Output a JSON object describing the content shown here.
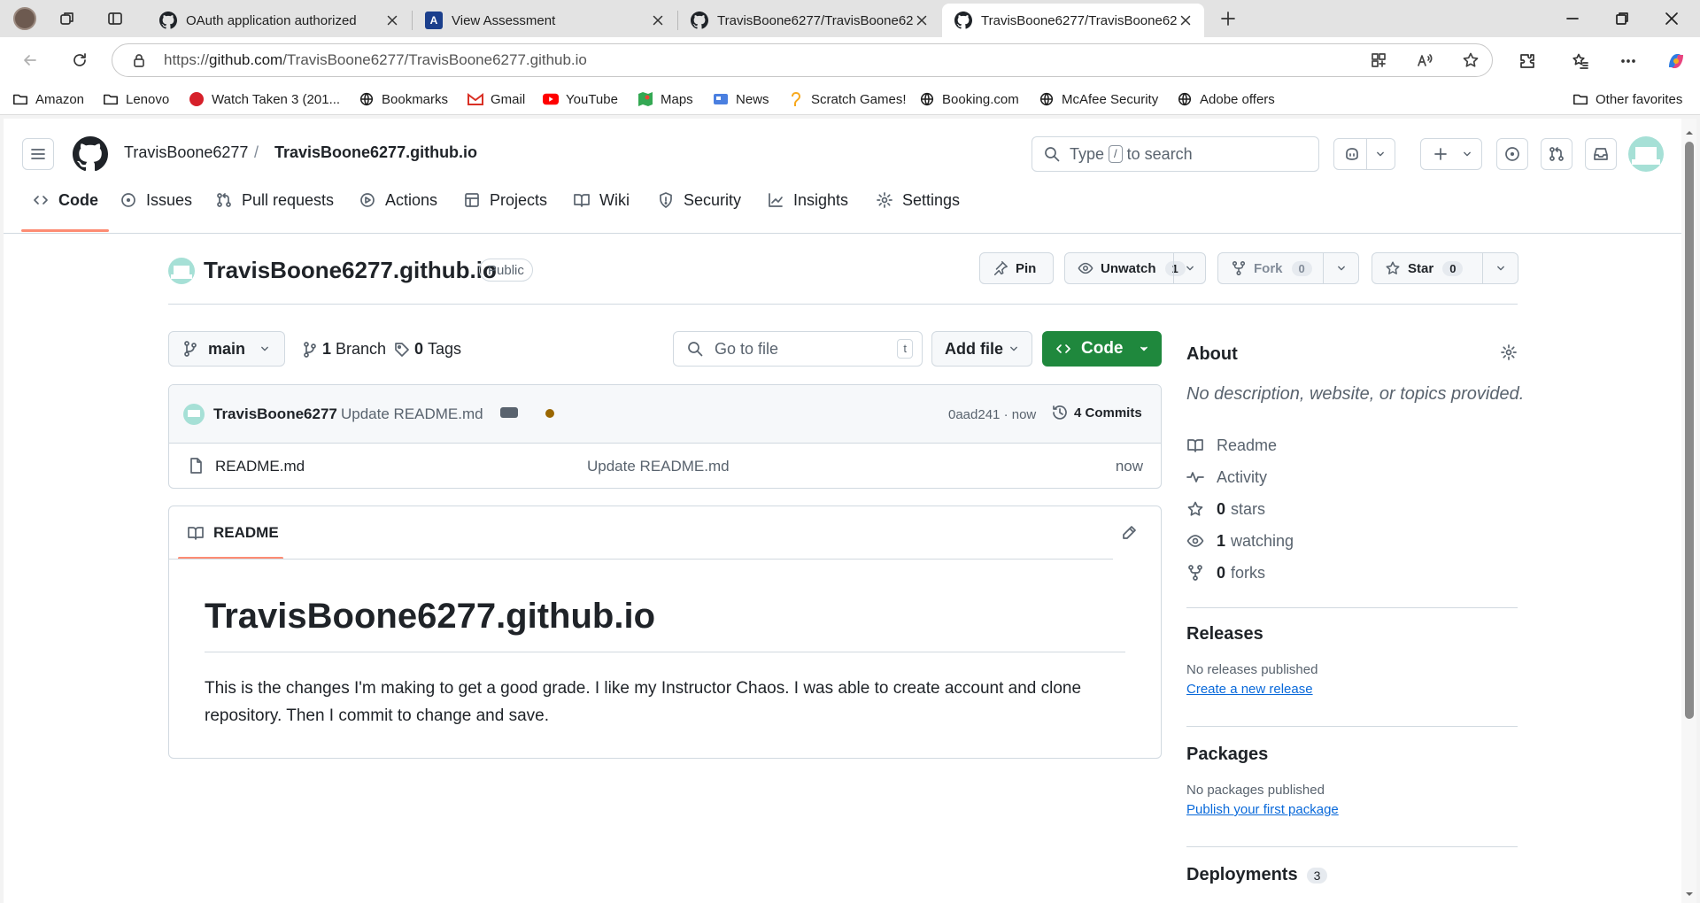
{
  "browser": {
    "tabs": [
      {
        "title": "OAuth application authorized",
        "icon": "github-icon"
      },
      {
        "title": "View Assessment",
        "icon": "assessment-icon"
      },
      {
        "title": "TravisBoone6277/TravisBoone6277.github.io",
        "icon": "github-icon"
      },
      {
        "title": "TravisBoone6277/TravisBoone6277.github.io",
        "icon": "github-icon"
      }
    ],
    "url_prefix": "https://",
    "url_host": "github.com",
    "url_path": "/TravisBoone6277/TravisBoone6277.github.io",
    "favorites": [
      "Amazon",
      "Lenovo",
      "Watch Taken 3 (201...",
      "Bookmarks",
      "Gmail",
      "YouTube",
      "Maps",
      "News",
      "Scratch Games!",
      "Booking.com",
      "McAfee Security",
      "Adobe offers"
    ],
    "other_favorites": "Other favorites"
  },
  "github": {
    "owner": "TravisBoone6277",
    "separator": "/",
    "repo": "TravisBoone6277.github.io",
    "search_prefix": "Type",
    "search_key": "/",
    "search_suffix": "to search",
    "nav": [
      "Code",
      "Issues",
      "Pull requests",
      "Actions",
      "Projects",
      "Wiki",
      "Security",
      "Insights",
      "Settings"
    ],
    "visibility": "Public",
    "pin": "Pin",
    "unwatch": "Unwatch",
    "watch_count": "1",
    "fork": "Fork",
    "fork_count": "0",
    "star": "Star",
    "star_count": "0",
    "branch_name": "main",
    "branches_count": "1",
    "branches_label": "Branch",
    "tags_count": "0",
    "tags_label": "Tags",
    "goto_placeholder": "Go to file",
    "goto_key": "t",
    "add_file": "Add file",
    "code_button": "Code",
    "commit": {
      "author": "TravisBoone6277",
      "message": "Update README.md",
      "sha": "0aad241",
      "time": "now",
      "commits_count": "4",
      "commits_label": "Commits"
    },
    "files": [
      {
        "name": "README.md",
        "message": "Update README.md",
        "time": "now"
      }
    ],
    "readme": {
      "tab": "README",
      "heading": "TravisBoone6277.github.io",
      "body": "This is the changes I'm making to get a good grade. I like my Instructor Chaos. I was able to create account and clone repository. Then I commit to change and save."
    },
    "about": {
      "title": "About",
      "description": "No description, website, or topics provided.",
      "readme": "Readme",
      "activity": "Activity",
      "stars_count": "0",
      "stars_label": "stars",
      "watching_count": "1",
      "watching_label": "watching",
      "forks_count": "0",
      "forks_label": "forks"
    },
    "releases": {
      "title": "Releases",
      "empty": "No releases published",
      "link": "Create a new release"
    },
    "packages": {
      "title": "Packages",
      "empty": "No packages published",
      "link": "Publish your first package"
    },
    "deployments": {
      "title": "Deployments",
      "count": "3"
    }
  },
  "colors": {
    "accent_green": "#1f883d",
    "link_blue": "#0969da",
    "tab_underline": "#fd8c73",
    "commit_status": "#9a6700"
  }
}
